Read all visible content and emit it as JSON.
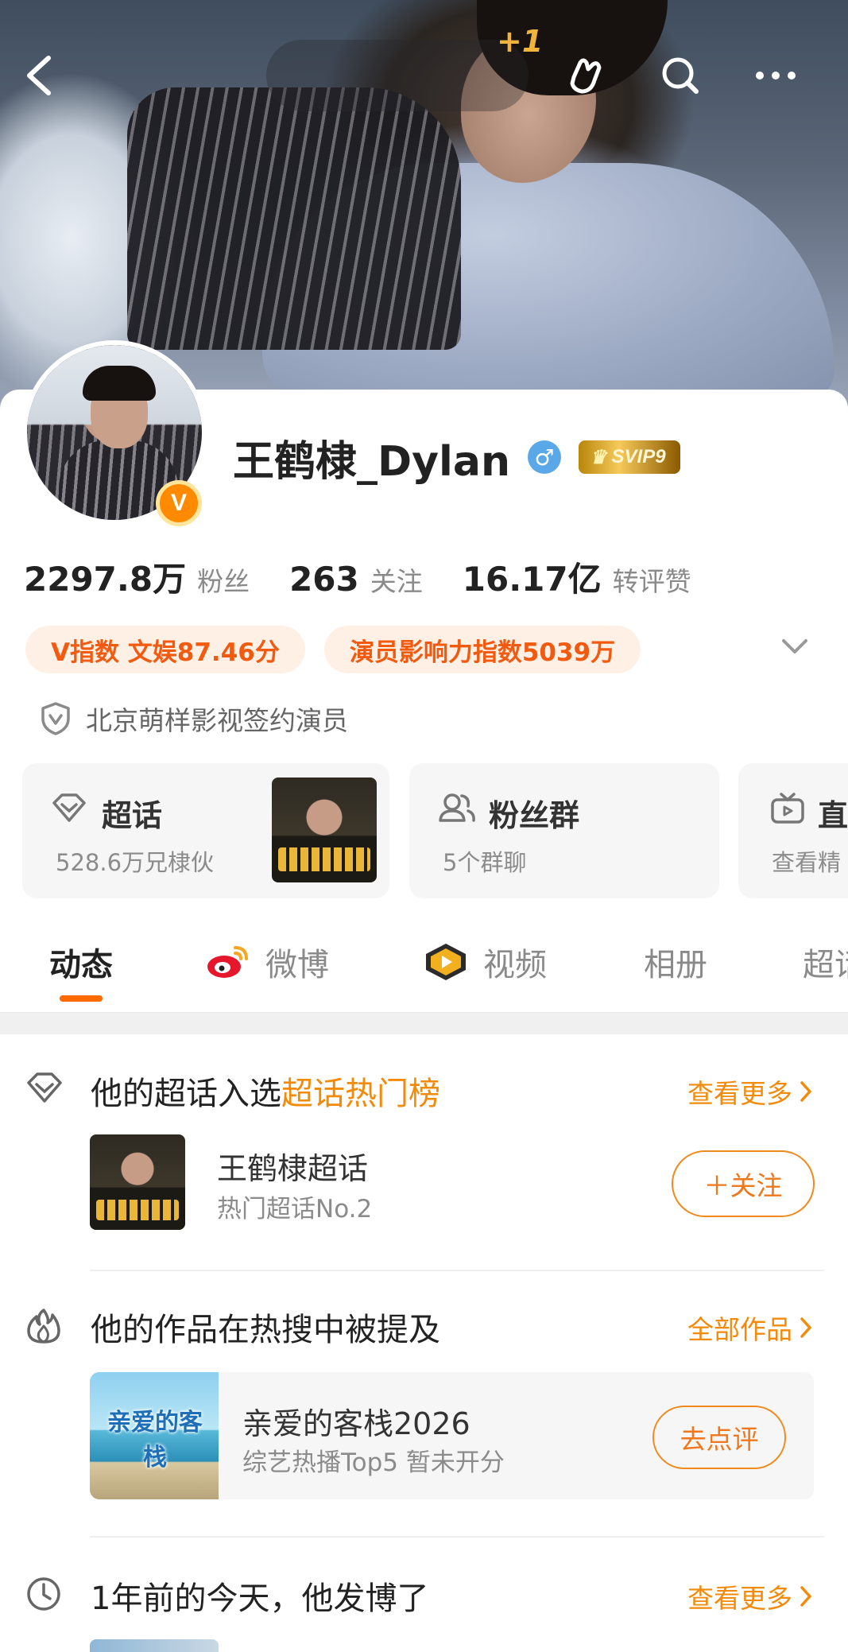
{
  "header": {
    "plus_one": "+1"
  },
  "profile": {
    "name": "王鹤棣_Dylan",
    "gender_symbol": "♂",
    "vip_badge": "SVIP9",
    "verified_badge_letter": "V",
    "stats": [
      {
        "value": "2297.8万",
        "label": "粉丝"
      },
      {
        "value": "263",
        "label": "关注"
      },
      {
        "value": "16.17亿",
        "label": "转评赞"
      }
    ],
    "tags": [
      "V指数 文娱87.46分",
      "演员影响力指数5039万"
    ],
    "verification": "北京萌样影视签约演员"
  },
  "feature_cards": [
    {
      "title": "超话",
      "subtitle": "528.6万兄棣伙"
    },
    {
      "title": "粉丝群",
      "subtitle": "5个群聊"
    },
    {
      "title": "直",
      "subtitle": "查看精"
    }
  ],
  "tabs": [
    {
      "label": "动态",
      "active": true
    },
    {
      "label": "微博",
      "active": false
    },
    {
      "label": "视频",
      "active": false
    },
    {
      "label": "相册",
      "active": false
    },
    {
      "label": "超话",
      "active": false
    }
  ],
  "sections": {
    "supertopic": {
      "title_prefix": "他的超话入选",
      "title_highlight": "超话热门榜",
      "more": "查看更多",
      "item_title": "王鹤棣超话",
      "item_sub": "热门超话No.2",
      "follow_button": "＋关注"
    },
    "works": {
      "title": "他的作品在热搜中被提及",
      "more": "全部作品",
      "show_thumb_text": "亲爱的客栈",
      "show_title": "亲爱的客栈2026",
      "show_sub": "综艺热播Top5 暂未开分",
      "rate_button": "去点评"
    },
    "memory": {
      "title": "1年前的今天，他发博了",
      "more": "查看更多"
    }
  },
  "colors": {
    "accent_orange": "#f28a0a",
    "tag_text": "#f25a10",
    "tab_underline": "#ff6a00",
    "gender_blue": "#5aa8e8"
  },
  "icons": [
    "back-arrow-icon",
    "hand-icon",
    "search-icon",
    "more-icon",
    "chevron-down-icon",
    "shield-icon",
    "diamond-icon",
    "people-icon",
    "tv-icon",
    "weibo-icon",
    "video-icon",
    "flame-icon",
    "clock-icon",
    "chevron-right-icon"
  ]
}
